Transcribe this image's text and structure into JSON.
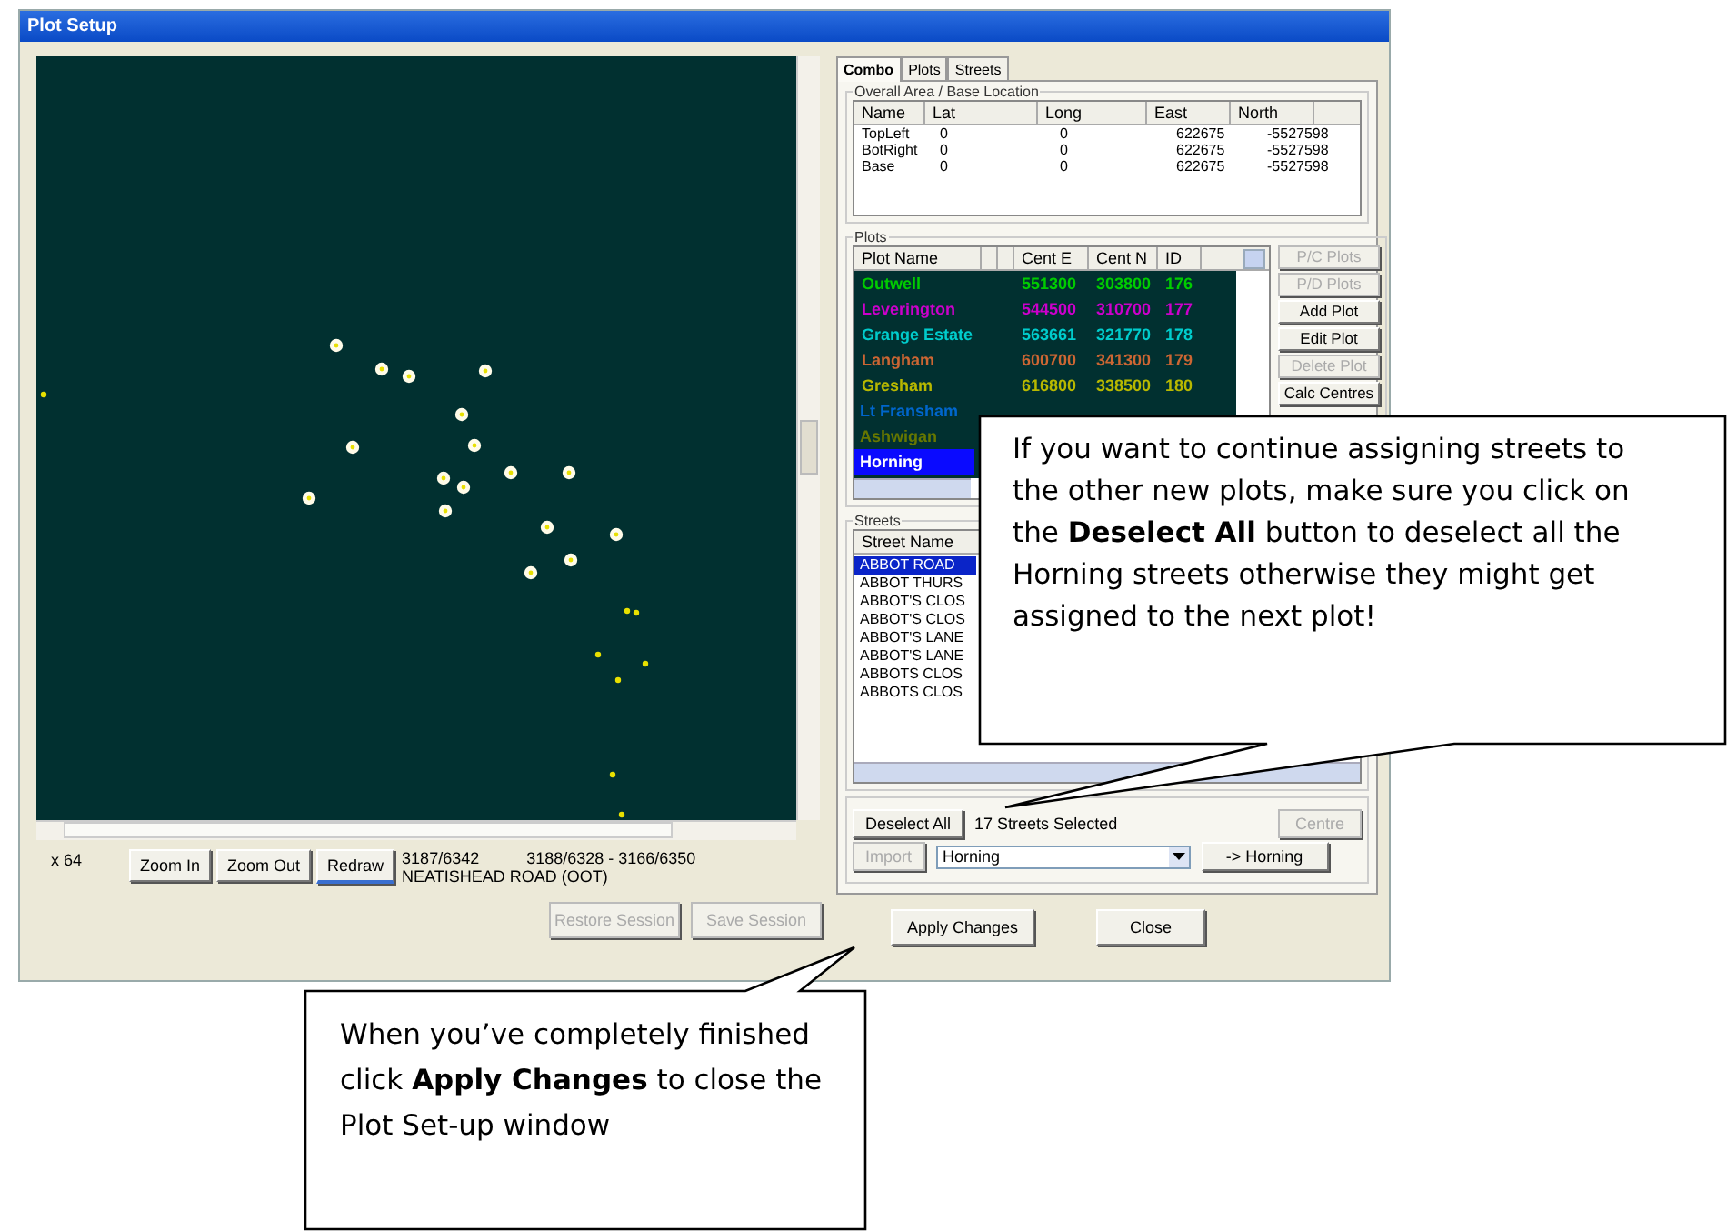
{
  "window": {
    "title": "Plot Setup"
  },
  "map": {
    "zoom_label": "x 64"
  },
  "map_buttons": [
    {
      "label": "Zoom In",
      "focused": false
    },
    {
      "label": "Zoom Out",
      "focused": false
    },
    {
      "label": "Redraw",
      "focused": true
    }
  ],
  "status": {
    "position": "3187/6342",
    "range": "3188/6328 - 3166/6350",
    "street": "NEATISHEAD ROAD (OOT)"
  },
  "session_buttons": [
    {
      "label": "Restore Session",
      "disabled": true
    },
    {
      "label": "Save Session",
      "disabled": true
    }
  ],
  "tabs": [
    {
      "label": "Combo",
      "selected": true
    },
    {
      "label": "Plots",
      "selected": false
    },
    {
      "label": "Streets",
      "selected": false
    }
  ],
  "overall_area": {
    "title": "Overall Area / Base Location",
    "columns": [
      "Name",
      "Lat",
      "Long",
      "East",
      "North"
    ],
    "rows": [
      [
        "TopLeft",
        "0",
        "0",
        "622675",
        "-5527598"
      ],
      [
        "BotRight",
        "0",
        "0",
        "622675",
        "-5527598"
      ],
      [
        "Base",
        "0",
        "0",
        "622675",
        "-5527598"
      ]
    ]
  },
  "plots": {
    "title": "Plots",
    "columns": [
      "Plot Name",
      "Cent E",
      "Cent N",
      "ID"
    ],
    "rows": [
      {
        "name": "Outwell",
        "cent_e": "551300",
        "cent_n": "303800",
        "id": "176",
        "color": "#00cc00",
        "selected": false
      },
      {
        "name": "Leverington",
        "cent_e": "544500",
        "cent_n": "310700",
        "id": "177",
        "color": "#cc00cc",
        "selected": false
      },
      {
        "name": "Grange Estate",
        "cent_e": "563661",
        "cent_n": "321770",
        "id": "178",
        "color": "#00cccc",
        "selected": false
      },
      {
        "name": "Langham",
        "cent_e": "600700",
        "cent_n": "341300",
        "id": "179",
        "color": "#cc6633",
        "selected": false
      },
      {
        "name": "Gresham",
        "cent_e": "616800",
        "cent_n": "338500",
        "id": "180",
        "color": "#b8b800",
        "selected": false
      },
      {
        "name": "Lt Fransham",
        "color": "#0066cc",
        "selected": false
      },
      {
        "name": "Ashwigan",
        "color": "#667700",
        "selected": false
      },
      {
        "name": "Horning",
        "selected": true
      }
    ],
    "buttons": [
      {
        "label": "P/C Plots",
        "disabled": true
      },
      {
        "label": "P/D Plots",
        "disabled": true
      },
      {
        "label": "Add Plot",
        "disabled": false
      },
      {
        "label": "Edit Plot",
        "disabled": false
      },
      {
        "label": "Delete Plot",
        "disabled": true
      },
      {
        "label": "Calc Centres",
        "disabled": false
      }
    ]
  },
  "streets": {
    "title": "Streets",
    "columns": [
      "Street Name"
    ],
    "rows": [
      {
        "name": "ABBOT ROAD",
        "selected": true
      },
      {
        "name": "ABBOT THURS",
        "selected": false
      },
      {
        "name": "ABBOT'S CLOS",
        "selected": false
      },
      {
        "name": "ABBOT'S CLOS",
        "selected": false
      },
      {
        "name": "ABBOT'S LANE",
        "selected": false
      },
      {
        "name": "ABBOT'S LANE",
        "selected": false
      },
      {
        "name": "ABBOTS CLOS",
        "selected": false
      },
      {
        "name": "ABBOTS CLOS",
        "selected": false
      }
    ],
    "deselect_button": {
      "label": "Deselect All",
      "disabled": false
    },
    "selected_count": "17 Streets Selected",
    "centre_button": {
      "label": "Centre",
      "disabled": true
    },
    "import_button": {
      "label": "Import",
      "disabled": true
    },
    "plot_dropdown": {
      "value": "Horning"
    },
    "assign_button": {
      "label": "-> Horning",
      "disabled": false
    }
  },
  "dialog_buttons": [
    {
      "label": "Apply Changes"
    },
    {
      "label": "Close"
    }
  ],
  "callouts": [
    {
      "text": "If you want to continue assigning streets to the other new plots, make sure you click on the **Deselect All** button to deselect all the Horning streets otherwise they might get assigned to the next plot!"
    },
    {
      "text": "When you’ve completely finished click **Apply Changes** to close the Plot Set-up window"
    }
  ]
}
